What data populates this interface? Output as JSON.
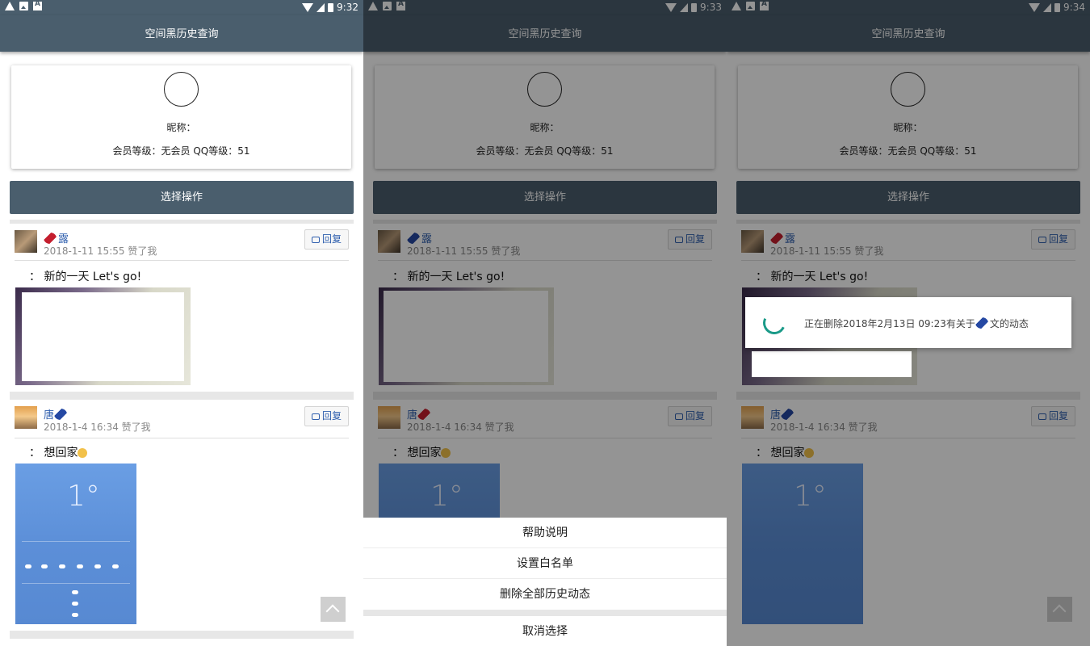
{
  "panels": [
    {
      "time": "9:32"
    },
    {
      "time": "9:33"
    },
    {
      "time": "9:34"
    }
  ],
  "app": {
    "title": "空间黑历史查询",
    "profile": {
      "nickname_label": "昵称：",
      "level_text": "会员等级：无会员  QQ等级：51"
    },
    "select_button": "选择操作",
    "reply_label": "回复",
    "posts": [
      {
        "name": "露",
        "meta": "2018-1-11 15:55   赞了我",
        "content": "：  新的一天 Let's go!"
      },
      {
        "name": "唐",
        "meta": "2018-1-4 16:34   赞了我",
        "content": "：  想回家"
      }
    ]
  },
  "weather_image": {
    "temperature": "1°"
  },
  "action_sheet": {
    "items": [
      "帮助说明",
      "设置白名单",
      "删除全部历史动态"
    ],
    "cancel": "取消选择"
  },
  "progress_dialog": {
    "text_before": "正在删除2018年2月13日 09:23有关于",
    "text_after": "文的动态"
  },
  "colors": {
    "primary": "#4a5e6d",
    "link": "#2f5fae",
    "spinner": "#1a9a88"
  }
}
